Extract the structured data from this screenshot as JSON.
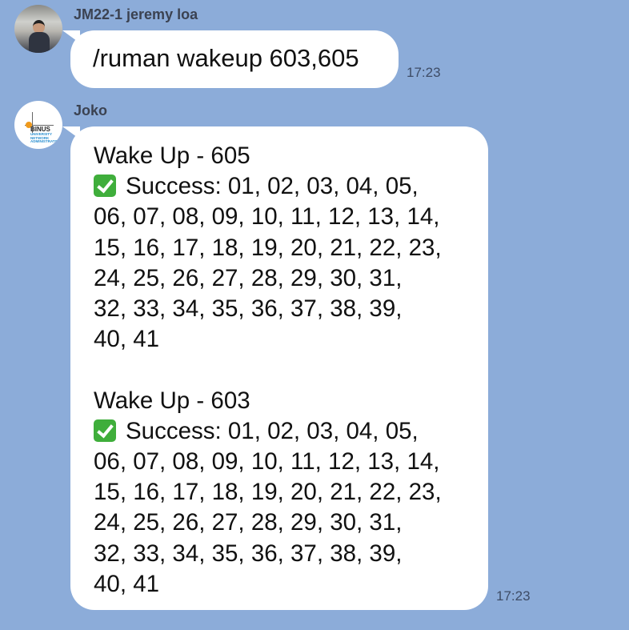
{
  "messages": [
    {
      "sender": "JM22-1 jeremy loa",
      "text": "/ruman wakeup 603,605",
      "time": "17:23"
    },
    {
      "sender": "Joko",
      "avatar_logo_text": "BINUS UNIVERSITY NETWORK ADMINISTRATOR",
      "time": "17:23",
      "blocks": [
        {
          "title": "Wake Up - 605",
          "icon": "check-mark-button-icon",
          "lines": [
            "Success: 01, 02, 03, 04, 05,",
            "06, 07, 08, 09, 10, 11, 12, 13, 14,",
            "15, 16, 17, 18, 19, 20, 21, 22, 23,",
            "24, 25, 26, 27, 28, 29, 30, 31,",
            "32, 33, 34, 35, 36, 37, 38, 39,",
            "40, 41"
          ]
        },
        {
          "title": "Wake Up - 603",
          "icon": "check-mark-button-icon",
          "lines": [
            "Success: 01, 02, 03, 04, 05,",
            "06, 07, 08, 09, 10, 11, 12, 13, 14,",
            "15, 16, 17, 18, 19, 20, 21, 22, 23,",
            "24, 25, 26, 27, 28, 29, 30, 31,",
            "32, 33, 34, 35, 36, 37, 38, 39,",
            "40, 41"
          ]
        }
      ]
    }
  ],
  "colors": {
    "background": "#8cacd9",
    "bubble": "#ffffff",
    "check": "#3fae3b"
  }
}
